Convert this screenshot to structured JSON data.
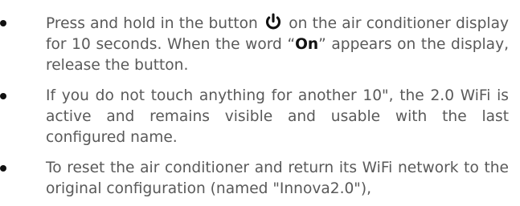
{
  "items": [
    {
      "before_icon": "Press and hold in the button",
      "icon": "power-icon",
      "after_icon": "on the air conditioner display for 10 seconds. When the word “",
      "bold": "On",
      "after_bold": "” appears on the display, release the button."
    },
    {
      "text": "If you do not touch anything for another 10\", the 2.0 WiFi is active and remains visible and usable with the last configured name."
    },
    {
      "text": "To reset the air conditioner and return its WiFi network to the original configuration (named \"Innova2.0\"),"
    }
  ]
}
